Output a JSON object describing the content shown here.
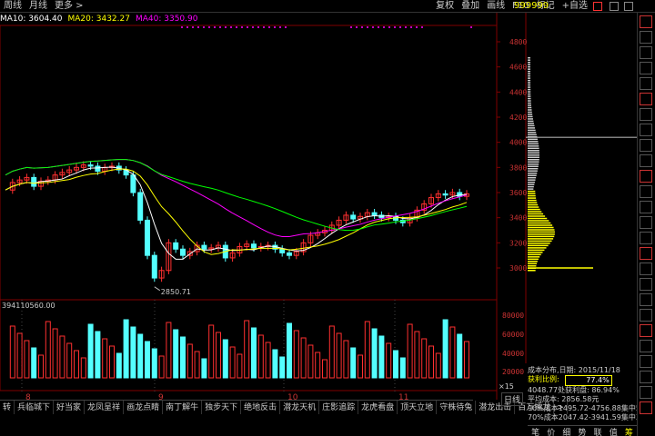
{
  "topbar": {
    "period_week": "周线",
    "period_month": "月线",
    "more": "更多 >",
    "fuquan": "复权",
    "overlay": "叠加",
    "draw": "画线",
    "f10": "F10",
    "mark": "标记",
    "add_self": "+自选",
    "stock_code": "999999"
  },
  "ma": {
    "ma10": "MA10: 3604.40",
    "ma20": "MA20: 3432.27",
    "ma40": "MA40: 3350.90"
  },
  "price_axis": [
    "4800",
    "4600",
    "4400",
    "4200",
    "4000",
    "3800",
    "3600",
    "3400",
    "3200",
    "3000"
  ],
  "low_label": "2850.71",
  "volume": {
    "label": "394110560.00",
    "axis": [
      "80000",
      "60000",
      "40000",
      "20000"
    ],
    "x_unit": "×15"
  },
  "month_labels": [
    "8",
    "9",
    "10",
    "11"
  ],
  "tabs": [
    "转",
    "兵临城下",
    "好当家",
    "龙凤呈祥",
    "画龙点睛",
    "南丁解牛",
    "独步天下",
    "绝地反击",
    "潜龙天机",
    "庄影追踪",
    "龙虎看盘",
    "顶天立地",
    "守株待兔",
    "潜龙出击",
    "百万擂龙",
    ">"
  ],
  "tab_week_line": "日线",
  "info": {
    "title": "成本分布,日期: 2015/11/18",
    "profit_ratio_label": "获利比例:",
    "profit_ratio": "77.4%",
    "profit_line": "4048.77处获利盘: 86.94%",
    "avg_cost": "平均成本: 2856.58元",
    "cost90": "90%成本1495.72-4756.88集中53.2%",
    "cost70": "70%成本2047.42-3941.59集中30.9%"
  },
  "bottom_tabs": [
    "笔",
    "价",
    "细",
    "势",
    "联",
    "值",
    "筹"
  ],
  "colors": {
    "up": "#ff3030",
    "down": "#54ffff",
    "ma10": "#ffffff",
    "ma20": "#ffff00",
    "ma40": "#ff00ff",
    "ma60": "#00ff00",
    "border": "#800000"
  }
}
